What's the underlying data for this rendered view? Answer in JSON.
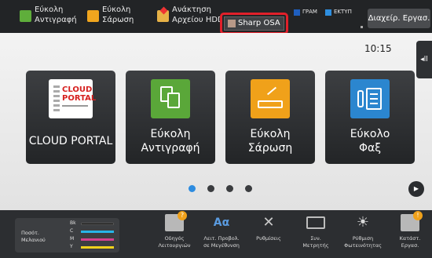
{
  "topbar": {
    "shortcuts": [
      {
        "label": "Εύκολη\nΑντιγραφή",
        "icon": "copy-icon"
      },
      {
        "label": "Εύκολη\nΣάρωση",
        "icon": "scan-icon"
      },
      {
        "label": "Ανάκτηση\nΑρχείου HDD",
        "icon": "folder-icon"
      }
    ],
    "sharp_osa": "Sharp OSA",
    "mode_print_label": "ΓΡΑΜ",
    "mode_print_color": "#1f5fbf",
    "mode_copy_label": "ΕΚΤΥΠ",
    "mode_copy_color": "#2e8fe0",
    "job_status_button": "Διαχείρ. Εργασ."
  },
  "main": {
    "time": "10:15",
    "side_tab_icon": "◂ll",
    "tiles": [
      {
        "label": "CLOUD PORTAL",
        "icon": "cloud-portal-icon",
        "icon_text": "CLOUD\nPORTAL"
      },
      {
        "label": "Εύκολη\nΑντιγραφή",
        "icon": "copy-icon"
      },
      {
        "label": "Εύκολη\nΣάρωση",
        "icon": "scan-icon"
      },
      {
        "label": "Εύκολο\nΦαξ",
        "icon": "fax-icon"
      }
    ],
    "pagination": {
      "current": 1,
      "total": 4
    },
    "active_dot_color": "#2d8ce0",
    "inactive_dot_color": "#3a3c3f"
  },
  "bottombar": {
    "toner": {
      "title": "Ποσότ.\nΜελανιού",
      "colors": [
        {
          "key": "Bk",
          "color": "#111111"
        },
        {
          "key": "C",
          "color": "#27b5e8"
        },
        {
          "key": "M",
          "color": "#d5418f"
        },
        {
          "key": "Y",
          "color": "#f0d21c"
        }
      ]
    },
    "functions": [
      {
        "label": "Οδηγός\nΛειτουργιών",
        "icon": "operation-guide-icon"
      },
      {
        "label": "Λειτ. Προβολ.\nσε Μεγέθυνση",
        "icon": "magnify-icon",
        "glyph": "Aα"
      },
      {
        "label": "Ρυθμίσεις",
        "icon": "settings-icon",
        "glyph": "✕"
      },
      {
        "label": "Συν.\nΜετρητής",
        "icon": "counter-icon"
      },
      {
        "label": "Ρύθμιση\nΦωτεινότητας",
        "icon": "brightness-icon",
        "glyph": "☀"
      },
      {
        "label": "Κατάστ.\nΕργασ.",
        "icon": "job-status-icon"
      }
    ]
  }
}
